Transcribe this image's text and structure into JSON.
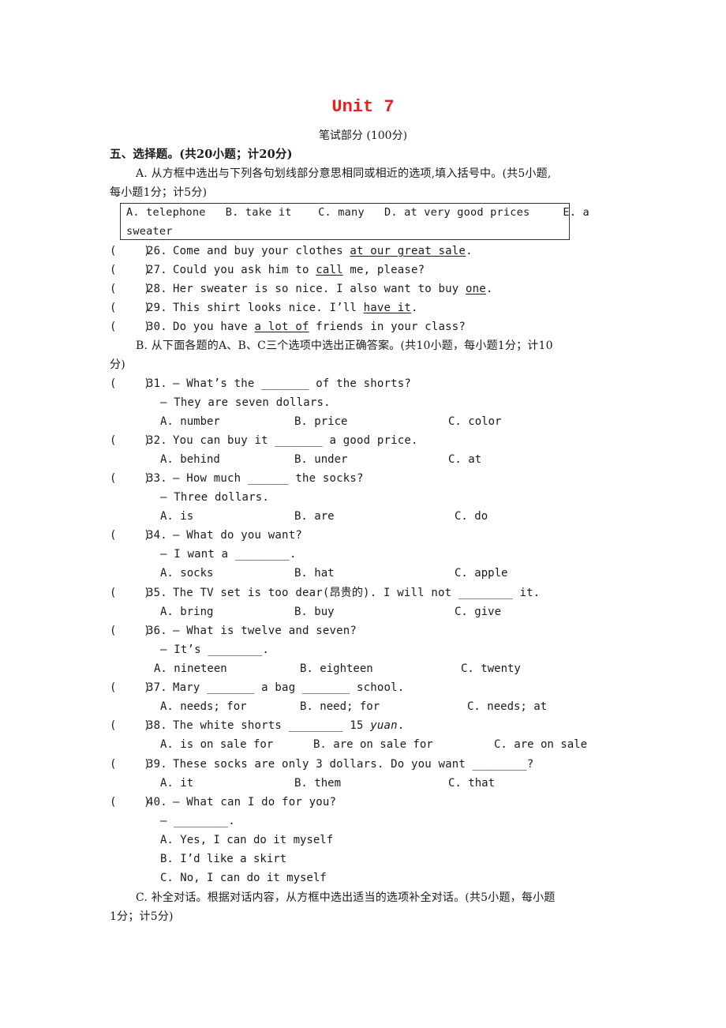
{
  "header": {
    "title": "Unit 7",
    "subtitle": "笔试部分 (100分)"
  },
  "section5": {
    "heading": "五、选择题。(共20小题；计20分)",
    "partA": {
      "instruction_line1": "A. 从方框中选出与下列各句划线部分意思相同或相近的选项,填入括号中。(共5小题,",
      "instruction_line2": "每小题1分；计5分)",
      "box_line1": "A. telephone   B. take it    C. many   D. at very good prices     E. a",
      "box_line2": "sweater",
      "questions": [
        {
          "num": "26.",
          "before": "Come and buy your clothes ",
          "underlined": "at our great sale",
          "after": "."
        },
        {
          "num": "27.",
          "before": "Could you ask him to ",
          "underlined": "call",
          "after": " me, please?"
        },
        {
          "num": "28.",
          "before": "Her sweater is so nice. I also want to buy ",
          "underlined": "one",
          "after": "."
        },
        {
          "num": "29.",
          "before": "This shirt looks nice. I’ll ",
          "underlined": "have it",
          "after": "."
        },
        {
          "num": "30.",
          "before": "Do you have ",
          "underlined": "a lot of",
          "after": " friends in your class?"
        }
      ]
    },
    "partB": {
      "instruction_line1": "B. 从下面各题的A、B、C三个选项中选出正确答案。(共10小题，每小题1分；计10",
      "instruction_line2": "分)",
      "questions": [
        {
          "num": "31.",
          "stem": "— What’s the _______ of the shorts?",
          "reply": "— They are seven dollars.",
          "options": [
            "A. number",
            "B. price",
            "C. color"
          ]
        },
        {
          "num": "32.",
          "stem": "You can buy it _______ a good price.",
          "options": [
            "A. behind",
            "B. under",
            "C. at"
          ]
        },
        {
          "num": "33.",
          "stem": "— How much ______ the socks?",
          "reply": "— Three dollars.",
          "options": [
            "A. is",
            "B. are",
            "C. do"
          ]
        },
        {
          "num": "34.",
          "stem": "— What do you want?",
          "reply": "— I want a ________.",
          "options": [
            "A. socks",
            "B. hat",
            "C. apple"
          ]
        },
        {
          "num": "35.",
          "stem": "The TV set is too dear(昂贵的). I will not ________ it.",
          "options": [
            "A. bring",
            "B. buy",
            "C. give"
          ]
        },
        {
          "num": "36.",
          "stem": "— What is twelve and seven?",
          "reply": "— It’s ________.",
          "options": [
            "A. nineteen",
            "B. eighteen",
            "C. twenty"
          ]
        },
        {
          "num": "37.",
          "stem": "Mary _______ a bag _______ school.",
          "options": [
            "A. needs; for",
            "B. need; for",
            "C. needs; at"
          ]
        },
        {
          "num": "38.",
          "stem_before": "The white shorts ________ 15 ",
          "stem_italic": "yuan",
          "stem_after": ".",
          "options": [
            "A. is on sale for",
            "B. are on sale for",
            "C. are on sale"
          ]
        },
        {
          "num": "39.",
          "stem": "These socks are only 3 dollars. Do you want ________?",
          "options": [
            "A. it",
            "B. them",
            "C. that"
          ]
        },
        {
          "num": "40.",
          "stem": "— What can I do for you?",
          "reply": "— ________.",
          "options": [
            "A. Yes, I can do it myself",
            "B. I’d like a skirt",
            "C. No, I can do it myself"
          ]
        }
      ]
    },
    "partC": {
      "instruction_line1": "C. 补全对话。根据对话内容，从方框中选出适当的选项补全对话。(共5小题，每小题",
      "instruction_line2": "1分；计5分)"
    }
  },
  "answer_paren": "(    )"
}
